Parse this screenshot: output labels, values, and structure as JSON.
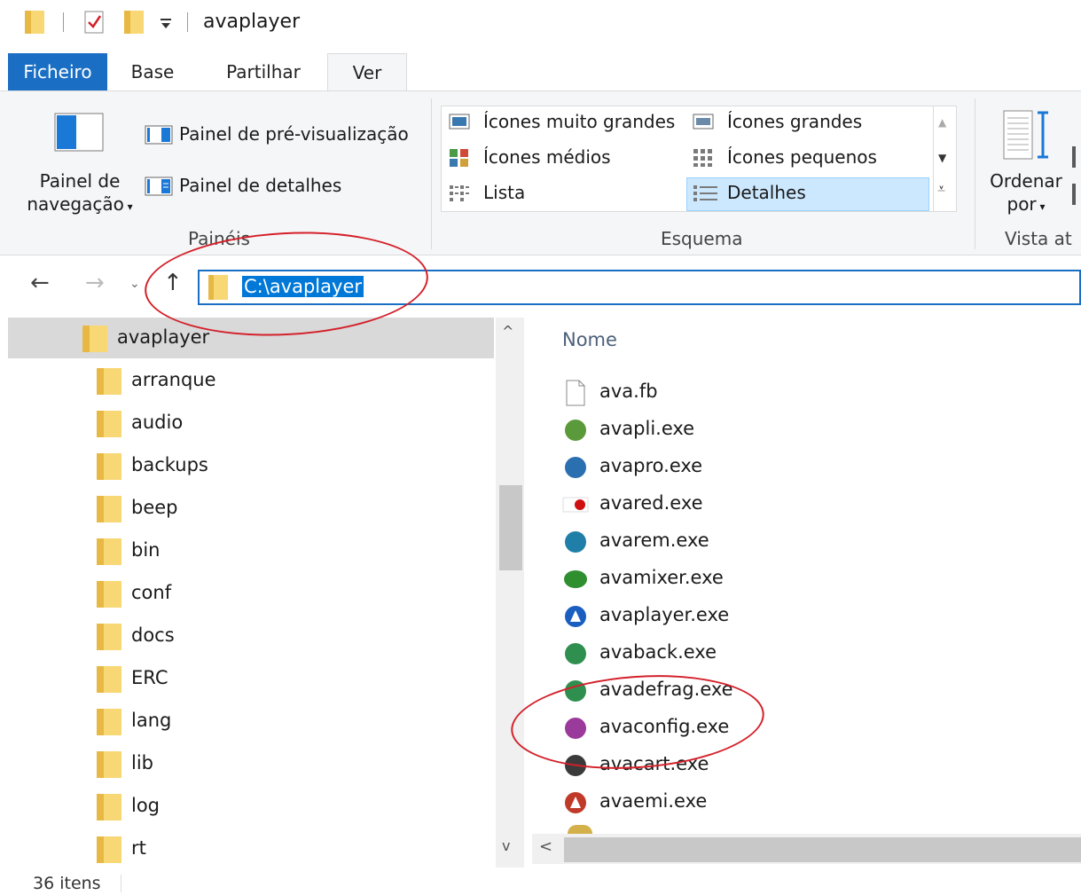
{
  "title_bar": {
    "window_title": "avaplayer"
  },
  "ribbon": {
    "tabs": [
      "Ficheiro",
      "Base",
      "Partilhar",
      "Ver"
    ],
    "active_tab": "Ver",
    "panes_group": {
      "navigation_pane_label_line1": "Painel de",
      "navigation_pane_label_line2": "navegação",
      "preview_pane": "Painel de pré-visualização",
      "details_pane": "Painel de detalhes",
      "group_label": "Painéis"
    },
    "layout_group": {
      "options": [
        "Ícones muito grandes",
        "Ícones grandes",
        "Ícones médios",
        "Ícones pequenos",
        "Lista",
        "Detalhes"
      ],
      "selected": "Detalhes",
      "group_label": "Esquema"
    },
    "current_view_group": {
      "sort_label_line1": "Ordenar",
      "sort_label_line2": "por",
      "group_label": "Vista at"
    }
  },
  "navigation": {
    "address": "C:\\avaplayer"
  },
  "tree": {
    "items": [
      "avaplayer",
      "arranque",
      "audio",
      "backups",
      "beep",
      "bin",
      "conf",
      "docs",
      "ERC",
      "lang",
      "lib",
      "log",
      "rt"
    ],
    "selected": "avaplayer"
  },
  "file_list": {
    "column_header": "Nome",
    "files": [
      "ava.fb",
      "avapli.exe",
      "avapro.exe",
      "avared.exe",
      "avarem.exe",
      "avamixer.exe",
      "avaplayer.exe",
      "avaback.exe",
      "avadefrag.exe",
      "avaconfig.exe",
      "avacart.exe",
      "avaemi.exe"
    ],
    "icon_colors": [
      "#ffffff",
      "#5a9a3a",
      "#2a6fb0",
      "#d01010",
      "#1f7fa8",
      "#2f8f2f",
      "#1a5fc0",
      "#2f8f4f",
      "#2f8f4f",
      "#9a3a9a",
      "#3a3a3a",
      "#c03a2a"
    ]
  },
  "status_bar": {
    "item_count": "36 itens"
  }
}
